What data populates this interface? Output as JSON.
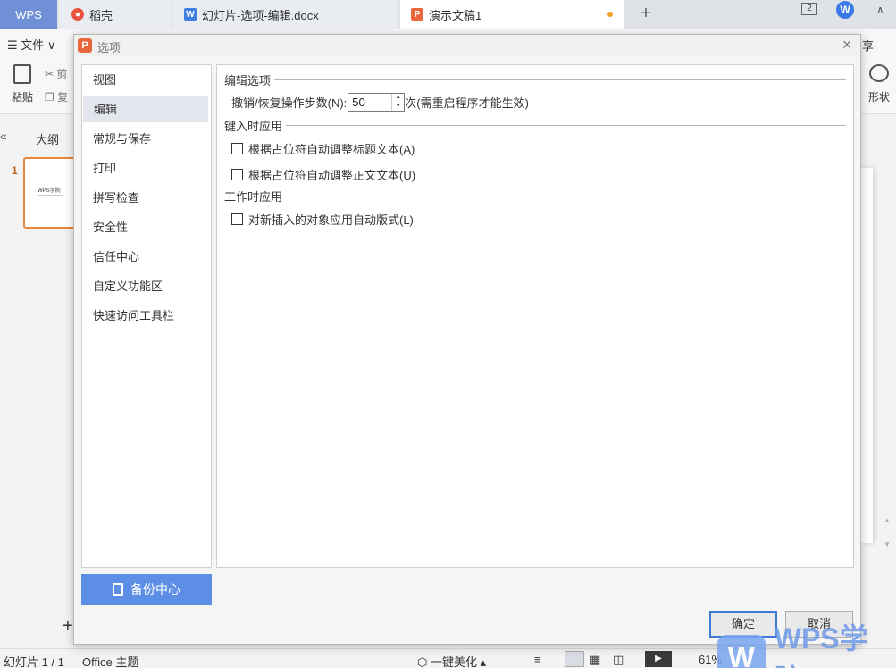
{
  "tabs": {
    "wps": "WPS",
    "daoke": "稻壳",
    "doc": "幻灯片-选项-编辑.docx",
    "ppt": "演示文稿1",
    "add": "+",
    "window_count": "2"
  },
  "menubar": {
    "file": "☰ 文件 ∨",
    "share_fragment": "享"
  },
  "ribbon": {
    "paste": "粘贴",
    "cut_fragment": "剪",
    "copy_fragment": "复",
    "shape": "形状"
  },
  "left_pane": {
    "outline_toggle": "«",
    "outline_tab": "大纲",
    "slide_number": "1",
    "thumb_title": "WPS学院",
    "add_slide": "+"
  },
  "statusbar": {
    "slide": "幻灯片 1 / 1",
    "theme": "Office 主题",
    "beautify": "一键美化",
    "zoom": "61%"
  },
  "dialog": {
    "title": "选项",
    "nav": [
      "视图",
      "编辑",
      "常规与保存",
      "打印",
      "拼写检查",
      "安全性",
      "信任中心",
      "自定义功能区",
      "快速访问工具栏"
    ],
    "selected_nav_index": 1,
    "backup_center": "备份中心",
    "sections": {
      "edit_options": "编辑选项",
      "typing": "键入时应用",
      "working": "工作时应用"
    },
    "undo_label": "撤销/恢复操作步数(N):",
    "undo_value": "50",
    "undo_suffix": "次(需重启程序才能生效)",
    "checks": {
      "auto_title": "根据占位符自动调整标题文本(A)",
      "auto_body": "根据占位符自动调整正文文本(U)",
      "auto_layout": "对新插入的对象应用自动版式(L)"
    },
    "ok": "确定",
    "cancel": "取消"
  },
  "watermark": {
    "logo_letter": "W",
    "text": "WPS学院"
  },
  "colors": {
    "accent_blue": "#5d8ee6",
    "ppt_orange": "#e8673d",
    "ok_border": "#3d7bd6"
  }
}
